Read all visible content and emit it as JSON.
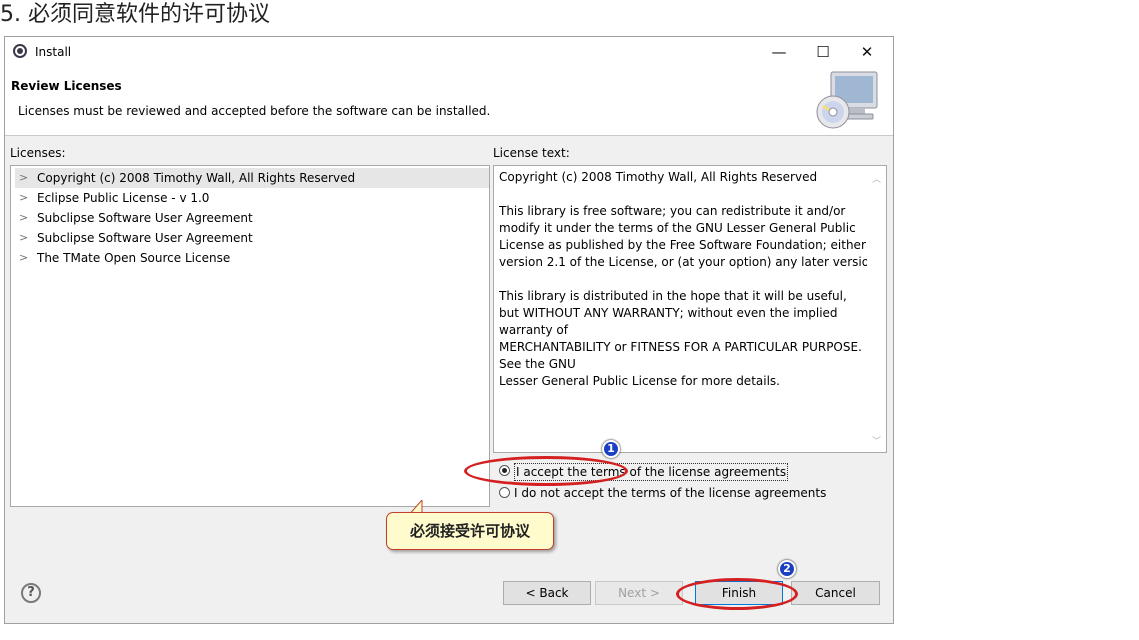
{
  "heading": "5. 必须同意软件的许可协议",
  "window": {
    "title": "Install",
    "controls": {
      "minimize": "—",
      "maximize": "☐",
      "close": "✕"
    }
  },
  "header": {
    "title": "Review Licenses",
    "description": "Licenses must be reviewed and accepted before the software can be installed."
  },
  "licenses": {
    "label": "Licenses:",
    "items": [
      {
        "label": "Copyright (c) 2008 Timothy Wall, All Rights Reserved",
        "selected": true
      },
      {
        "label": "Eclipse Public License - v 1.0",
        "selected": false
      },
      {
        "label": "Subclipse Software User Agreement",
        "selected": false
      },
      {
        "label": "Subclipse Software User Agreement",
        "selected": false
      },
      {
        "label": "The TMate Open Source License",
        "selected": false
      }
    ]
  },
  "license_text": {
    "label": "License text:",
    "content": "Copyright (c) 2008 Timothy Wall, All Rights Reserved\n\nThis library is free software; you can redistribute it and/or\nmodify it under the terms of the GNU Lesser General Public\nLicense as published by the Free Software Foundation; either\nversion 2.1 of the License, or (at your option) any later version.\n\nThis library is distributed in the hope that it will be useful,\nbut WITHOUT ANY WARRANTY; without even the implied\nwarranty of\nMERCHANTABILITY or FITNESS FOR A PARTICULAR PURPOSE.\nSee the GNU\nLesser General Public License for more details."
  },
  "options": {
    "accept": {
      "label": "I accept the terms of the license agreements",
      "selected": true
    },
    "decline": {
      "label": "I do not accept the terms of the license agreements",
      "selected": false
    }
  },
  "annotation": {
    "callout": "必须接受许可协议",
    "badge1": "1",
    "badge2": "2",
    "highlight_color": "#d42020",
    "badge_color": "#1c3fc4"
  },
  "buttons": {
    "help": "?",
    "back": "< Back",
    "next": "Next >",
    "finish": "Finish",
    "cancel": "Cancel"
  }
}
